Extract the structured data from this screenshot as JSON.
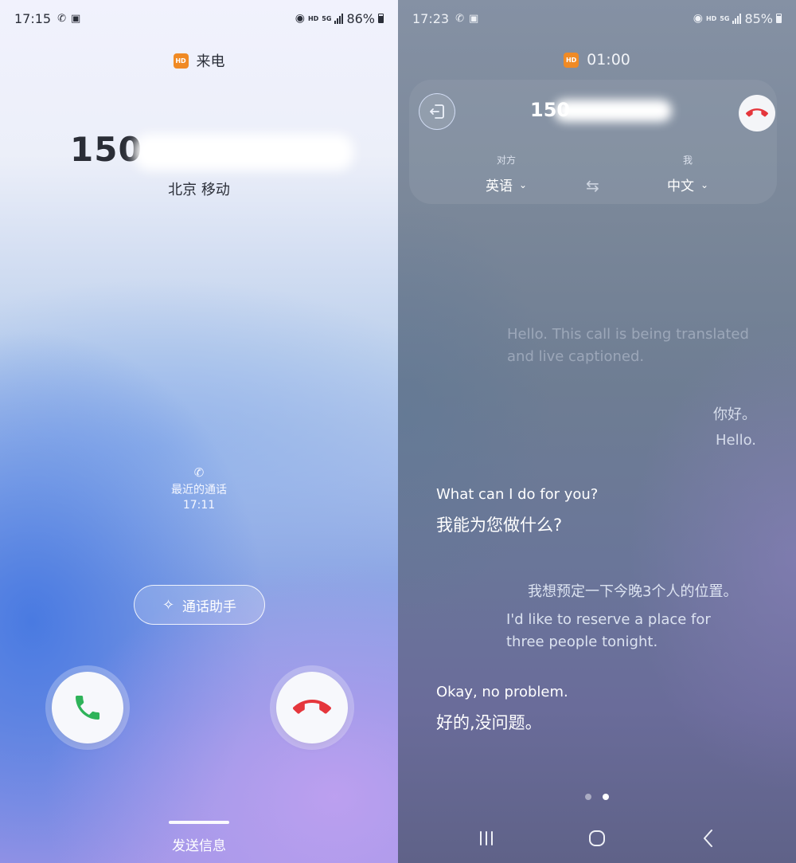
{
  "left": {
    "status": {
      "time": "17:15",
      "network_hd": "HD",
      "network_gen": "5G",
      "battery": "86%"
    },
    "title": {
      "badge": "HD",
      "label": "来电"
    },
    "caller": {
      "number_visible": "150",
      "location": "北京 移动"
    },
    "recent_call": {
      "label": "最近的通话",
      "time": "17:11"
    },
    "assistant_button": "通话助手",
    "buttons": {
      "accept": "accept-call",
      "decline": "decline-call"
    },
    "send_message": "发送信息"
  },
  "right": {
    "status": {
      "time": "17:23",
      "network_hd": "HD",
      "network_gen": "5G",
      "battery": "85%"
    },
    "call": {
      "badge": "HD",
      "duration": "01:00",
      "number_visible": "150"
    },
    "languages": {
      "them_role": "对方",
      "them_lang": "英语",
      "me_role": "我",
      "me_lang": "中文"
    },
    "transcript": {
      "faded": "Hello. This call is being translated and live captioned.",
      "msg1_zh": "你好。",
      "msg1_en": "Hello.",
      "msg2_en": "What can I do for you?",
      "msg2_zh": "我能为您做什么?",
      "msg3_zh": "我想预定一下今晚3个人的位置。",
      "msg3_en": "I'd like to reserve a place for three people tonight.",
      "msg4_en": "Okay, no problem.",
      "msg4_zh": "好的,没问题。"
    },
    "pager": {
      "pages": 2,
      "current": 2
    }
  },
  "colors": {
    "accept_green": "#2fb35a",
    "decline_red": "#e5363c",
    "hd_badge": "#f08a24"
  }
}
